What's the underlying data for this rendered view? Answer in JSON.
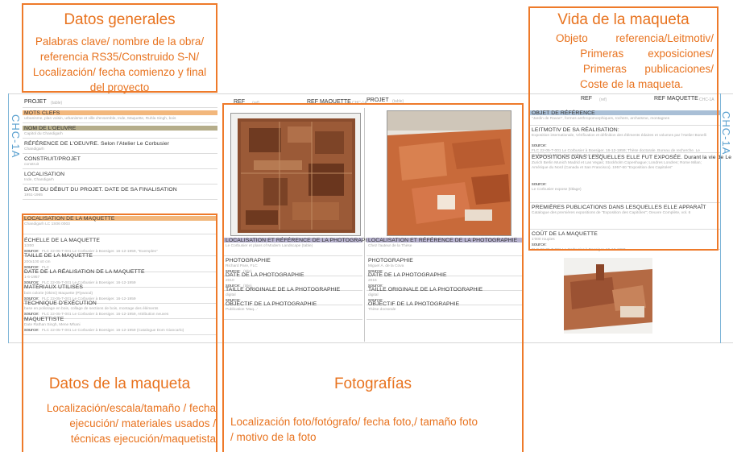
{
  "annotations": {
    "datos_generales": {
      "title": "Datos generales",
      "lines": [
        "Palabras clave/ nombre de la obra/",
        "referencia RS35/Construido S-N/",
        "Localización/ fecha comienzo y final",
        "del proyecto"
      ]
    },
    "vida_maqueta": {
      "title": "Vida de la maqueta",
      "lines": [
        "Objeto        referencia/Leitmotiv/",
        "Primeras        exposiciones/",
        "Primeras      publicaciones/",
        "Coste de la maqueta."
      ]
    },
    "datos_maqueta": {
      "title": "Datos de la maqueta",
      "lines": [
        "Localización/escala/tamaño / fecha",
        "ejecución/ materiales usados /",
        "técnicas ejecución/maquetista"
      ]
    },
    "fotografias": {
      "title": "Fotografías",
      "lines": [
        "Localización foto/fotógrafo/ fecha foto,/ tamaño foto",
        "/ motivo de la foto"
      ]
    }
  },
  "sheet": {
    "chc_label": "CHC-1A",
    "left_header": {
      "label": "PROJET",
      "value": "(table)"
    },
    "middle_header": {
      "ref": "REF",
      "ref_val": "(ref)",
      "ref_maquette": "REF MAQUETTE",
      "ref_maquette_val": "CHC-1A",
      "projet": "PROJET",
      "projet_val": "(table)"
    },
    "right_header": {
      "ref": "REF",
      "ref_val": "(ref)",
      "ref_maquette": "REF MAQUETTE",
      "ref_maquette_val": "CHC-1A"
    },
    "left_general": [
      {
        "label": "MOTS CLEFS",
        "value": "urbanisme, plan voisin, urbanisme et ville d'ensemble, Inde, Maquette, Ruhla Singh, bois",
        "bar": "orange"
      },
      {
        "label": "NOM DE L'OEUVRE",
        "value": "Capitol du Chandigarh",
        "bar": "khaki"
      },
      {
        "label": "RÉFÉRENCE DE L'OEUVRE. Selon l'Atelier Le Corbusier",
        "value": "Chandigarh",
        "bar": ""
      },
      {
        "label": "CONSTRUIT/PROJET",
        "value": "construit",
        "bar": ""
      },
      {
        "label": "LOCALISATION",
        "value": "Inde, Chandigarh",
        "bar": ""
      },
      {
        "label": "DATE DU DÉBUT DU PROJET. DATE DE SA FINALISATION",
        "value": "1951-1965",
        "bar": ""
      }
    ],
    "left_maquette": [
      {
        "label": "LOCALISATION DE LA MAQUETTE",
        "value": "Chandigarh LC 1S06 0003",
        "bar": "orange"
      },
      {
        "label": "ÉCHELLE DE LA MAQUETTE",
        "value": "1/200",
        "bar": "",
        "source": "source:",
        "source_val": "FLC 22-05-T-001 Le Corbusier à Boesiger. 16-12-1959, \"Exemples\""
      },
      {
        "label": "TAILLE DE LA MAQUETTE",
        "value": "200x100 x0 cm",
        "bar": "",
        "source": "source:",
        "source_val": "FLC"
      },
      {
        "label": "DATE DE LA RÉALISATION DE LA MAQUETTE",
        "value": "1-6-1957",
        "bar": "",
        "source": "source:",
        "source_val": "FLC 22-05-T-001 Le Corbusier à Boesiger. 16-12-1959"
      },
      {
        "label": "MATÉRIAUX UTILISÉS",
        "value": "bois colorie (Okimi) Maquette (Plywood)",
        "bar": "",
        "source": "source:",
        "source_val": "FLC 22-05-T-001 Le Corbusier à Boesiger. 16-12-1959"
      },
      {
        "label": "TECHNIQUE D'EXÉCUTION",
        "value": "base en poliorage en bois, collage de sections de bois, montage des éléments",
        "bar": "",
        "source": "source:",
        "source_val": "FLC 22-05-T-001 Le Corbusier à Boesiger. 16-12-1959, Attribution neuves"
      },
      {
        "label": "MAQUETTISTE",
        "value": "Date Rathan Singh, Mene Mhani",
        "bar": "",
        "source": "source:",
        "source_val": "FLC 22-05-T-001 Le Corbusier à Boesiger. 16-12-1959 (Catalogue Dom Giancarlo)"
      }
    ],
    "photo_col_a": [
      {
        "label": "LOCALISATION ET RÉFÉRENCE DE LA PHOTOGRAPHIE",
        "value": "Le Corbusier et plans of Modern Landscape (table)",
        "bar": "lav"
      },
      {
        "label": "PHOTOGRAPHIE",
        "value": "Richard Pare, FLC",
        "source": "source:",
        "source_val": "(title)"
      },
      {
        "label": "DATE DE LA PHOTOGRAPHIE",
        "value": "2010",
        "source": "source:",
        "source_val": "(title)"
      },
      {
        "label": "TAILLE ORIGINALE DE LA PHOTOGRAPHIE",
        "value": "digital",
        "source": "source:",
        "source_val": ""
      },
      {
        "label": "OBJECTIF DE LA PHOTOGRAPHIE",
        "value": "Publication 'Maq...'"
      }
    ],
    "photo_col_b": [
      {
        "label": "LOCALISATION ET RÉFÉRENCE DE LA PHOTOGRAPHIE",
        "value": "Chez l'auteur de la Thèse",
        "bar": "lav"
      },
      {
        "label": "PHOTOGRAPHIE",
        "value": "Miguel Á. de la Cova",
        "source": "source:",
        "source_val": ""
      },
      {
        "label": "DATE DE LA PHOTOGRAPHIE",
        "value": "2015",
        "source": "source:",
        "source_val": ""
      },
      {
        "label": "TAILLE ORIGINALE DE LA PHOTOGRAPHIE",
        "value": "digital",
        "source": "source:",
        "source_val": ""
      },
      {
        "label": "OBJECTIF DE LA PHOTOGRAPHIE",
        "value": "Thèse doctorale"
      }
    ],
    "right_rows": [
      {
        "label": "OBJET DE RÉFÉRENCE",
        "value": "\"Jardin de Ravan\", formes anthropomorphiques, rochers, archaïsme, montagnes",
        "bar": "blue"
      },
      {
        "label": "LEITMOTIV DE SA RÉALISATION:",
        "value": "Exposition internationale, Vérification et définition des éléments édaires et volumes par l'Atelier Bonelli",
        "source": "source:",
        "source_val": "FLC 22-05-T-001 Le Corbusier à Boesiger. 16-12-1959; Thèse doctorale. Bureau de recherche. Le Corbusier à 1957. FLC 16/86, FLC 16/217"
      },
      {
        "label": "EXPOSITIONS DANS LESQUELLES ELLE FUT EXPOSÉE. Durant la vie de Le Corbusier",
        "value": "Zurich Berlin Munich Madrid et Las Vegas; Stockholm Copenhague; Londres Londres; Rome Milan; Amérique du Nord (Canada et San Francisco). 1957-60 \"Exposition des Capitoles\"",
        "source": "source:",
        "source_val": "Le Corbusier expose (titlage)"
      },
      {
        "label": "PREMIÈRES PUBLICATIONS DANS LESQUELLES ELLE APPARAÎT",
        "value": "Catalogue des premières expositions de \"Exposition des Capitoles\"; Oeuvre Complète, vol. 6",
        "source": "",
        "source_val": ""
      },
      {
        "label": "COÛT DE LA MAQUETTE",
        "value": "1'000 roupies",
        "source": "source:",
        "source_val": "FLC 22-05-T-001 Le Corbusier à Boesiger. 16-12-1959"
      }
    ]
  }
}
